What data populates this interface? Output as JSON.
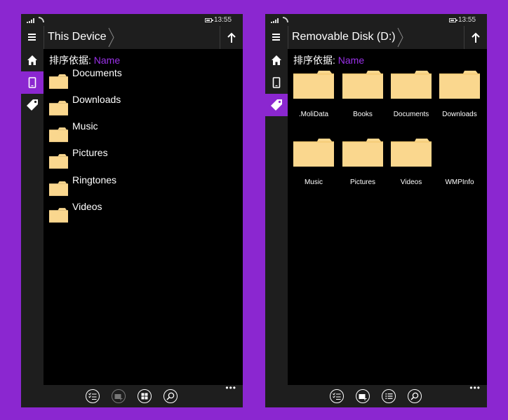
{
  "status": {
    "time": "13:55"
  },
  "sort": {
    "label": "排序依据:",
    "value": "Name"
  },
  "left": {
    "title": "This Device",
    "items": [
      {
        "label": "Documents"
      },
      {
        "label": "Downloads"
      },
      {
        "label": "Music"
      },
      {
        "label": "Pictures"
      },
      {
        "label": "Ringtones"
      },
      {
        "label": "Videos"
      }
    ]
  },
  "right": {
    "title": "Removable Disk (D:)",
    "tiles": [
      {
        "label": ".MoliData",
        "has_folder": true
      },
      {
        "label": "Books",
        "has_folder": true
      },
      {
        "label": "Documents",
        "has_folder": true
      },
      {
        "label": "Downloads",
        "has_folder": true
      },
      {
        "label": "Music",
        "has_folder": true
      },
      {
        "label": "Pictures",
        "has_folder": true
      },
      {
        "label": "Videos",
        "has_folder": true
      },
      {
        "label": "WMPInfo",
        "has_folder": false
      }
    ]
  },
  "icons": {
    "menu": "hamburger-icon",
    "up": "up-arrow-icon",
    "home": "home-icon",
    "device": "phone-icon",
    "tag": "tag-icon",
    "select": "checklist-icon",
    "new_folder": "new-folder-icon",
    "grid_view": "grid-view-icon",
    "list_view": "list-view-icon",
    "search": "search-icon",
    "more": "more-icon"
  },
  "colors": {
    "accent": "#8B27D0",
    "folder": "#FAD78E",
    "chrome": "#1E1E1E"
  }
}
